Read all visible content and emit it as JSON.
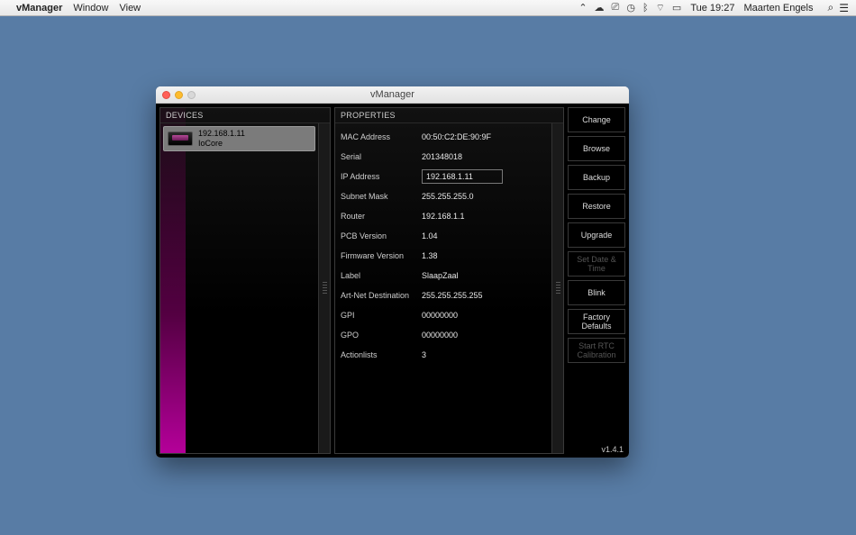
{
  "menubar": {
    "app_name": "vManager",
    "menus": [
      "Window",
      "View"
    ],
    "clock": "Tue 19:27",
    "user": "Maarten Engels"
  },
  "window": {
    "title": "vManager",
    "version": "v1.4.1"
  },
  "devices": {
    "header": "DEVICES",
    "items": [
      {
        "ip": "192.168.1.11",
        "name": "IoCore"
      }
    ]
  },
  "properties": {
    "header": "PROPERTIES",
    "rows": [
      {
        "label": "MAC Address",
        "value": "00:50:C2:DE:90:9F"
      },
      {
        "label": "Serial",
        "value": "201348018"
      },
      {
        "label": "IP Address",
        "value": "192.168.1.11",
        "editable": true
      },
      {
        "label": "Subnet Mask",
        "value": "255.255.255.0"
      },
      {
        "label": "Router",
        "value": "192.168.1.1"
      },
      {
        "label": "PCB Version",
        "value": "1.04"
      },
      {
        "label": "Firmware Version",
        "value": "1.38"
      },
      {
        "label": "Label",
        "value": "SlaapZaal"
      },
      {
        "label": "Art-Net Destination",
        "value": "255.255.255.255"
      },
      {
        "label": "GPI",
        "value": "00000000"
      },
      {
        "label": "GPO",
        "value": "00000000"
      },
      {
        "label": "Actionlists",
        "value": "3"
      }
    ]
  },
  "actions": [
    {
      "label": "Change",
      "enabled": true
    },
    {
      "label": "Browse",
      "enabled": true
    },
    {
      "label": "Backup",
      "enabled": true
    },
    {
      "label": "Restore",
      "enabled": true
    },
    {
      "label": "Upgrade",
      "enabled": true
    },
    {
      "label": "Set Date & Time",
      "enabled": false
    },
    {
      "label": "Blink",
      "enabled": true
    },
    {
      "label": "Factory Defaults",
      "enabled": true
    },
    {
      "label": "Start RTC Calibration",
      "enabled": false
    }
  ]
}
